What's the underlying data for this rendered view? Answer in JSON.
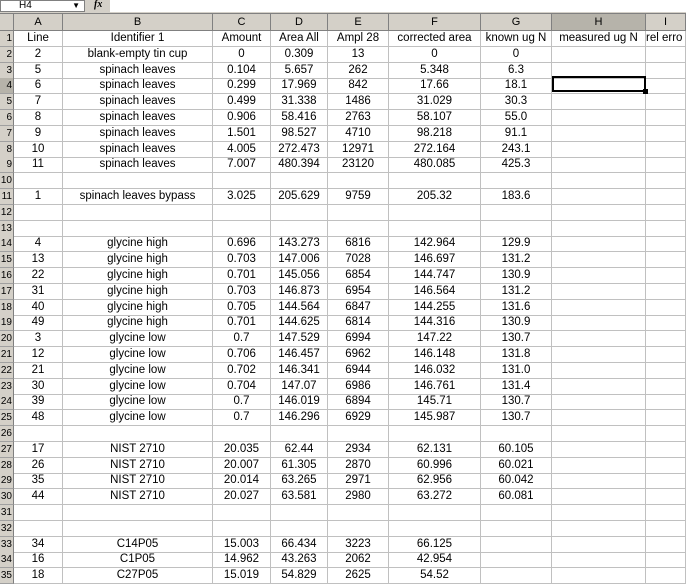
{
  "name_box": "H4",
  "formula_icon": "fx",
  "formula_value": "",
  "columns": [
    {
      "letter": "A"
    },
    {
      "letter": "B"
    },
    {
      "letter": "C"
    },
    {
      "letter": "D"
    },
    {
      "letter": "E"
    },
    {
      "letter": "F"
    },
    {
      "letter": "G"
    },
    {
      "letter": "H"
    },
    {
      "letter": "I"
    }
  ],
  "selected_cell": "H4",
  "rows": [
    {
      "n": "1",
      "c": [
        "Line",
        "Identifier 1",
        "Amount",
        "Area All",
        "Ampl 28",
        "corrected area",
        "known ug N",
        "measured ug N",
        "rel erro"
      ]
    },
    {
      "n": "2",
      "c": [
        "2",
        "blank-empty tin cup",
        "0",
        "0.309",
        "13",
        "0",
        "0",
        "",
        ""
      ]
    },
    {
      "n": "3",
      "c": [
        "5",
        "spinach leaves",
        "0.104",
        "5.657",
        "262",
        "5.348",
        "6.3",
        "",
        ""
      ]
    },
    {
      "n": "4",
      "c": [
        "6",
        "spinach leaves",
        "0.299",
        "17.969",
        "842",
        "17.66",
        "18.1",
        "",
        ""
      ]
    },
    {
      "n": "5",
      "c": [
        "7",
        "spinach leaves",
        "0.499",
        "31.338",
        "1486",
        "31.029",
        "30.3",
        "",
        ""
      ]
    },
    {
      "n": "6",
      "c": [
        "8",
        "spinach leaves",
        "0.906",
        "58.416",
        "2763",
        "58.107",
        "55.0",
        "",
        ""
      ]
    },
    {
      "n": "7",
      "c": [
        "9",
        "spinach leaves",
        "1.501",
        "98.527",
        "4710",
        "98.218",
        "91.1",
        "",
        ""
      ]
    },
    {
      "n": "8",
      "c": [
        "10",
        "spinach leaves",
        "4.005",
        "272.473",
        "12971",
        "272.164",
        "243.1",
        "",
        ""
      ]
    },
    {
      "n": "9",
      "c": [
        "11",
        "spinach leaves",
        "7.007",
        "480.394",
        "23120",
        "480.085",
        "425.3",
        "",
        ""
      ]
    },
    {
      "n": "10",
      "c": [
        "",
        "",
        "",
        "",
        "",
        "",
        "",
        "",
        ""
      ]
    },
    {
      "n": "11",
      "c": [
        "1",
        "spinach leaves bypass",
        "3.025",
        "205.629",
        "9759",
        "205.32",
        "183.6",
        "",
        ""
      ]
    },
    {
      "n": "12",
      "c": [
        "",
        "",
        "",
        "",
        "",
        "",
        "",
        "",
        ""
      ]
    },
    {
      "n": "13",
      "c": [
        "",
        "",
        "",
        "",
        "",
        "",
        "",
        "",
        ""
      ]
    },
    {
      "n": "14",
      "c": [
        "4",
        "glycine high",
        "0.696",
        "143.273",
        "6816",
        "142.964",
        "129.9",
        "",
        ""
      ]
    },
    {
      "n": "15",
      "c": [
        "13",
        "glycine high",
        "0.703",
        "147.006",
        "7028",
        "146.697",
        "131.2",
        "",
        ""
      ]
    },
    {
      "n": "16",
      "c": [
        "22",
        "glycine high",
        "0.701",
        "145.056",
        "6854",
        "144.747",
        "130.9",
        "",
        ""
      ]
    },
    {
      "n": "17",
      "c": [
        "31",
        "glycine high",
        "0.703",
        "146.873",
        "6954",
        "146.564",
        "131.2",
        "",
        ""
      ]
    },
    {
      "n": "18",
      "c": [
        "40",
        "glycine high",
        "0.705",
        "144.564",
        "6847",
        "144.255",
        "131.6",
        "",
        ""
      ]
    },
    {
      "n": "19",
      "c": [
        "49",
        "glycine high",
        "0.701",
        "144.625",
        "6814",
        "144.316",
        "130.9",
        "",
        ""
      ]
    },
    {
      "n": "20",
      "c": [
        "3",
        "glycine low",
        "0.7",
        "147.529",
        "6994",
        "147.22",
        "130.7",
        "",
        ""
      ]
    },
    {
      "n": "21",
      "c": [
        "12",
        "glycine low",
        "0.706",
        "146.457",
        "6962",
        "146.148",
        "131.8",
        "",
        ""
      ]
    },
    {
      "n": "22",
      "c": [
        "21",
        "glycine low",
        "0.702",
        "146.341",
        "6944",
        "146.032",
        "131.0",
        "",
        ""
      ]
    },
    {
      "n": "23",
      "c": [
        "30",
        "glycine low",
        "0.704",
        "147.07",
        "6986",
        "146.761",
        "131.4",
        "",
        ""
      ]
    },
    {
      "n": "24",
      "c": [
        "39",
        "glycine low",
        "0.7",
        "146.019",
        "6894",
        "145.71",
        "130.7",
        "",
        ""
      ]
    },
    {
      "n": "25",
      "c": [
        "48",
        "glycine low",
        "0.7",
        "146.296",
        "6929",
        "145.987",
        "130.7",
        "",
        ""
      ]
    },
    {
      "n": "26",
      "c": [
        "",
        "",
        "",
        "",
        "",
        "",
        "",
        "",
        ""
      ]
    },
    {
      "n": "27",
      "c": [
        "17",
        "NIST 2710",
        "20.035",
        "62.44",
        "2934",
        "62.131",
        "60.105",
        "",
        ""
      ]
    },
    {
      "n": "28",
      "c": [
        "26",
        "NIST 2710",
        "20.007",
        "61.305",
        "2870",
        "60.996",
        "60.021",
        "",
        ""
      ]
    },
    {
      "n": "29",
      "c": [
        "35",
        "NIST 2710",
        "20.014",
        "63.265",
        "2971",
        "62.956",
        "60.042",
        "",
        ""
      ]
    },
    {
      "n": "30",
      "c": [
        "44",
        "NIST 2710",
        "20.027",
        "63.581",
        "2980",
        "63.272",
        "60.081",
        "",
        ""
      ]
    },
    {
      "n": "31",
      "c": [
        "",
        "",
        "",
        "",
        "",
        "",
        "",
        "",
        ""
      ]
    },
    {
      "n": "32",
      "c": [
        "",
        "",
        "",
        "",
        "",
        "",
        "",
        "",
        ""
      ]
    },
    {
      "n": "33",
      "c": [
        "34",
        "C14P05",
        "15.003",
        "66.434",
        "3223",
        "66.125",
        "",
        "",
        ""
      ]
    },
    {
      "n": "34",
      "c": [
        "16",
        "C1P05",
        "14.962",
        "43.263",
        "2062",
        "42.954",
        "",
        "",
        ""
      ]
    },
    {
      "n": "35",
      "c": [
        "18",
        "C27P05",
        "15.019",
        "54.829",
        "2625",
        "54.52",
        "",
        "",
        ""
      ]
    }
  ]
}
